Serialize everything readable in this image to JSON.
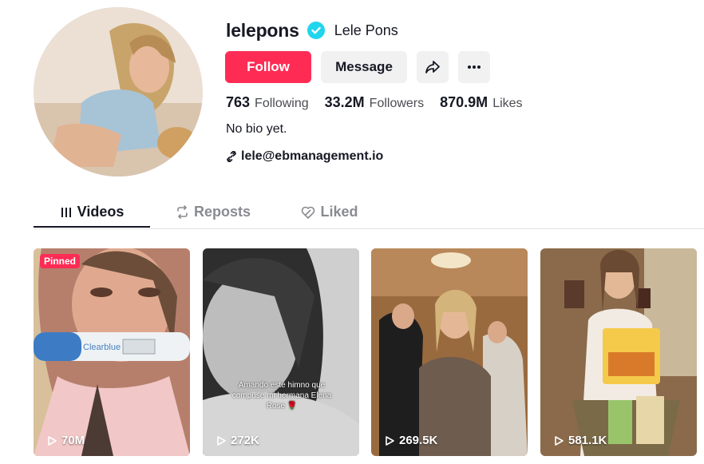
{
  "profile": {
    "username": "lelepons",
    "nickname": "Lele Pons",
    "bio": "No bio yet.",
    "link": "lele@ebmanagement.io"
  },
  "actions": {
    "follow_label": "Follow",
    "message_label": "Message"
  },
  "stats": [
    {
      "value": "763",
      "label": "Following"
    },
    {
      "value": "33.2M",
      "label": "Followers"
    },
    {
      "value": "870.9M",
      "label": "Likes"
    }
  ],
  "tabs": [
    {
      "label": "Videos",
      "icon": "grid-lines-icon",
      "active": true
    },
    {
      "label": "Reposts",
      "icon": "repost-icon",
      "active": false
    },
    {
      "label": "Liked",
      "icon": "heart-outline-icon",
      "active": false
    }
  ],
  "videos": [
    {
      "views": "70M",
      "badge": "Pinned"
    },
    {
      "views": "272K",
      "caption": "Amando este himno que compuse mi hermana Elena Rose 🌹"
    },
    {
      "views": "269.5K"
    },
    {
      "views": "581.1K"
    }
  ],
  "colors": {
    "accent": "#fe2c55",
    "verified": "#20d5ec",
    "text": "#161823",
    "secondary_bg": "#f1f1f2"
  }
}
